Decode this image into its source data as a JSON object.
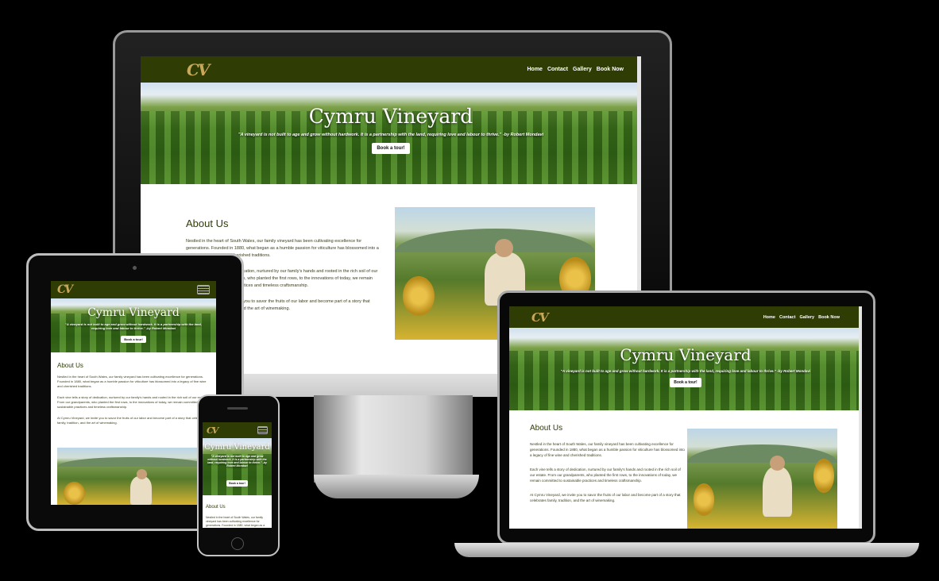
{
  "site": {
    "logo": "CV",
    "nav": [
      "Home",
      "Contact",
      "Gallery",
      "Book Now"
    ],
    "hero_title": "Cymru Vineyard",
    "hero_quote": "\"A vineyard is not built to age and grow without hardwork. It is a partnership with the land, requiring love and labour to thrive.\" -by Robert Mondavi",
    "book_button": "Book a tour!",
    "about_heading": "About Us",
    "paragraphs": [
      "Nestled in the heart of South Wales, our family vineyard has been cultivating excellence for generations. Founded in 1880, what began as a humble passion for viticulture has blossomed into a legacy of fine wine and cherished traditions.",
      "Each vine tells a story of dedication, nurtured by our family's hands and rooted in the rich soil of our estate. From our grandparents, who planted the first rows, to the innovations of today, we remain committed to sustainable practices and timeless craftsmanship.",
      "At Cymru Vineyard, we invite you to savor the fruits of our labor and become part of a story that celebrates family, tradition, and the art of winemaking."
    ]
  },
  "colors": {
    "nav_bg": "#2f3d05",
    "logo_gold": "#c9a85a",
    "heading": "#2f3d05"
  }
}
